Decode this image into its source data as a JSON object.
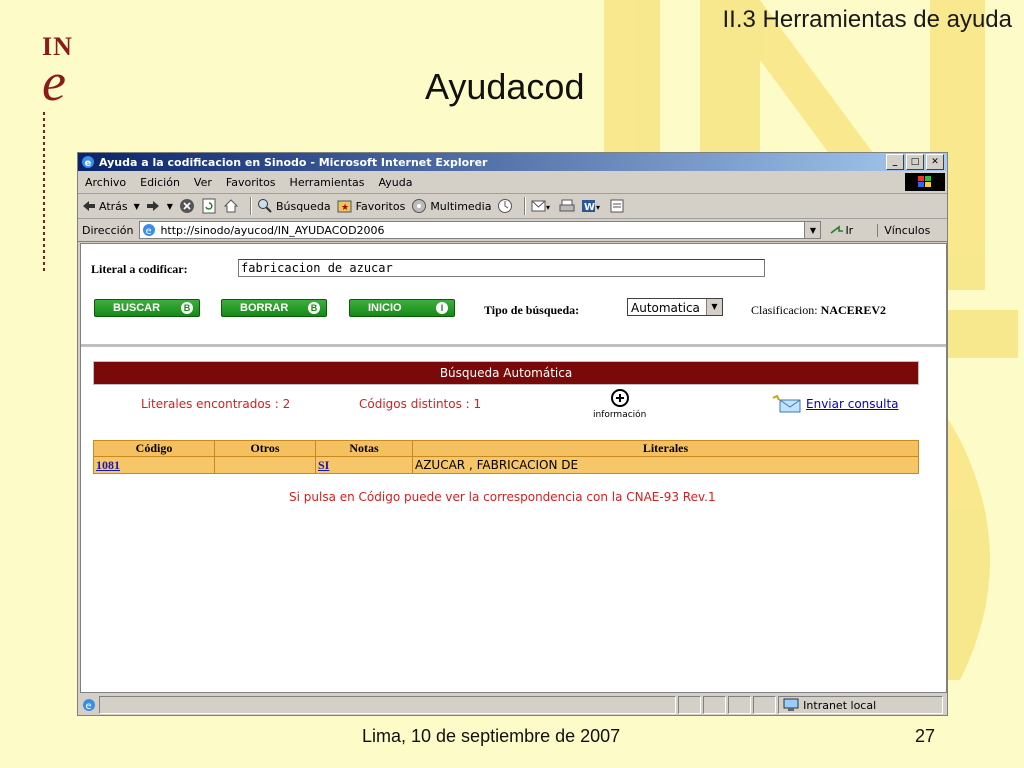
{
  "slide": {
    "section": "II.3 Herramientas de ayuda",
    "title": "Ayudacod",
    "logo_top": "IN",
    "logo_bottom": "e",
    "footer_date": "Lima, 10 de septiembre de 2007",
    "page_number": "27"
  },
  "browser": {
    "title": "Ayuda a la codificacion en Sinodo - Microsoft Internet Explorer",
    "menu": [
      "Archivo",
      "Edición",
      "Ver",
      "Favoritos",
      "Herramientas",
      "Ayuda"
    ],
    "toolbar": {
      "back": "Atrás",
      "search": "Búsqueda",
      "favorites": "Favoritos",
      "multimedia": "Multimedia"
    },
    "address_label": "Dirección",
    "address_url": "http://sinodo/ayucod/IN_AYUDACOD2006",
    "go_label": "Ir",
    "links_label": "Vínculos",
    "status_zone": "Intranet local"
  },
  "form": {
    "literal_label": "Literal a codificar:",
    "literal_value": "fabricacion de azucar",
    "buttons": [
      {
        "label": "BUSCAR",
        "key": "B"
      },
      {
        "label": "BORRAR",
        "key": "B"
      },
      {
        "label": "INICIO",
        "key": "I"
      }
    ],
    "tipo_label": "Tipo de búsqueda:",
    "tipo_value": "Automatica",
    "clasif_label": "Clasificacion:",
    "clasif_value": "NACEREV2"
  },
  "results": {
    "header": "Búsqueda Automática",
    "literales_found": "Literales encontrados : 2",
    "codigos_distintos": "Códigos distintos : 1",
    "info_label": "información",
    "enviar_label": "Enviar consulta",
    "columns": [
      "Código",
      "Otros",
      "Notas",
      "Literales"
    ],
    "rows": [
      {
        "codigo": "1081",
        "otros": "",
        "notas": "SI",
        "literales": "AZUCAR , FABRICACION DE"
      }
    ],
    "note": "Si pulsa en Código puede ver la correspondencia con la CNAE-93 Rev.1"
  }
}
